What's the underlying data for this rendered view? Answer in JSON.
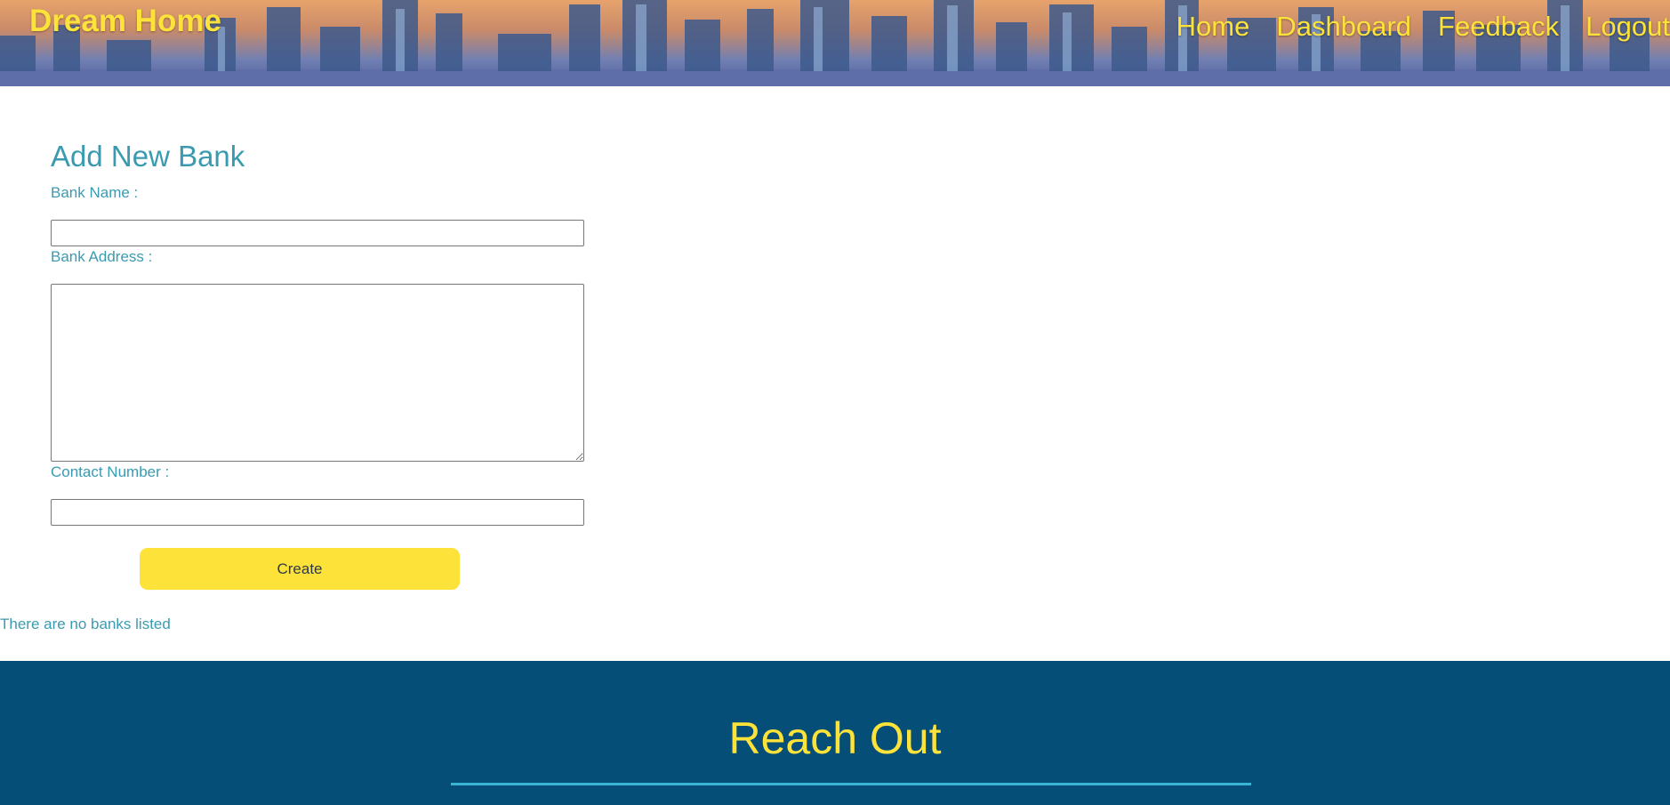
{
  "header": {
    "brand": "Dream Home",
    "nav": {
      "home": "Home",
      "dashboard": "Dashboard",
      "feedback": "Feedback",
      "logout": "Logout"
    }
  },
  "form": {
    "title": "Add New Bank",
    "bank_name_label": "Bank Name :",
    "bank_name_value": "",
    "bank_address_label": "Bank Address :",
    "bank_address_value": "",
    "contact_number_label": "Contact Number :",
    "contact_number_value": "",
    "create_label": "Create"
  },
  "empty_message": "There are no banks listed",
  "footer": {
    "title": "Reach Out"
  },
  "colors": {
    "accent_yellow": "#fde23a",
    "label_teal": "#3a9bb0",
    "footer_blue": "#044e78",
    "rule_cyan": "#3ab4d4"
  }
}
